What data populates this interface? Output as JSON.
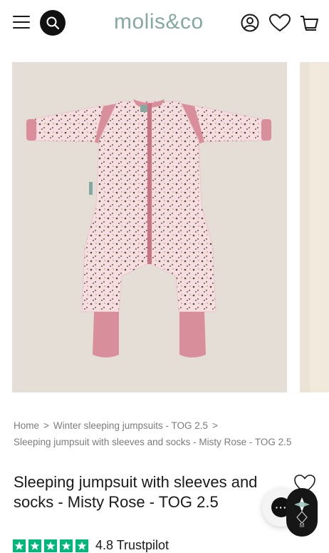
{
  "header": {
    "logo_text": "molis&co",
    "icons": [
      "menu-icon",
      "search-icon",
      "account-icon",
      "heart-icon",
      "cart-icon"
    ],
    "colors": {
      "logo": "#86a8a1",
      "search_bg": "#111111"
    }
  },
  "gallery": {
    "colors": {
      "main_bg": "#e5ded7",
      "garment": "#f6dde0",
      "cuffs": "#d88e9b",
      "next_bg": "#ebe3d6"
    }
  },
  "breadcrumb": {
    "home": "Home",
    "separator": ">",
    "category": "Winter sleeping jumpsuits - TOG 2.5",
    "current": "Sleeping jumpsuit with sleeves and socks - Misty Rose - TOG 2.5"
  },
  "product": {
    "title": "Sleeping jumpsuit with sleeves and socks - Misty Rose - TOG 2.5",
    "rating_text": "4.8 Trustpilot",
    "star_color": "#00b67a"
  },
  "chat": {
    "label": "···"
  }
}
